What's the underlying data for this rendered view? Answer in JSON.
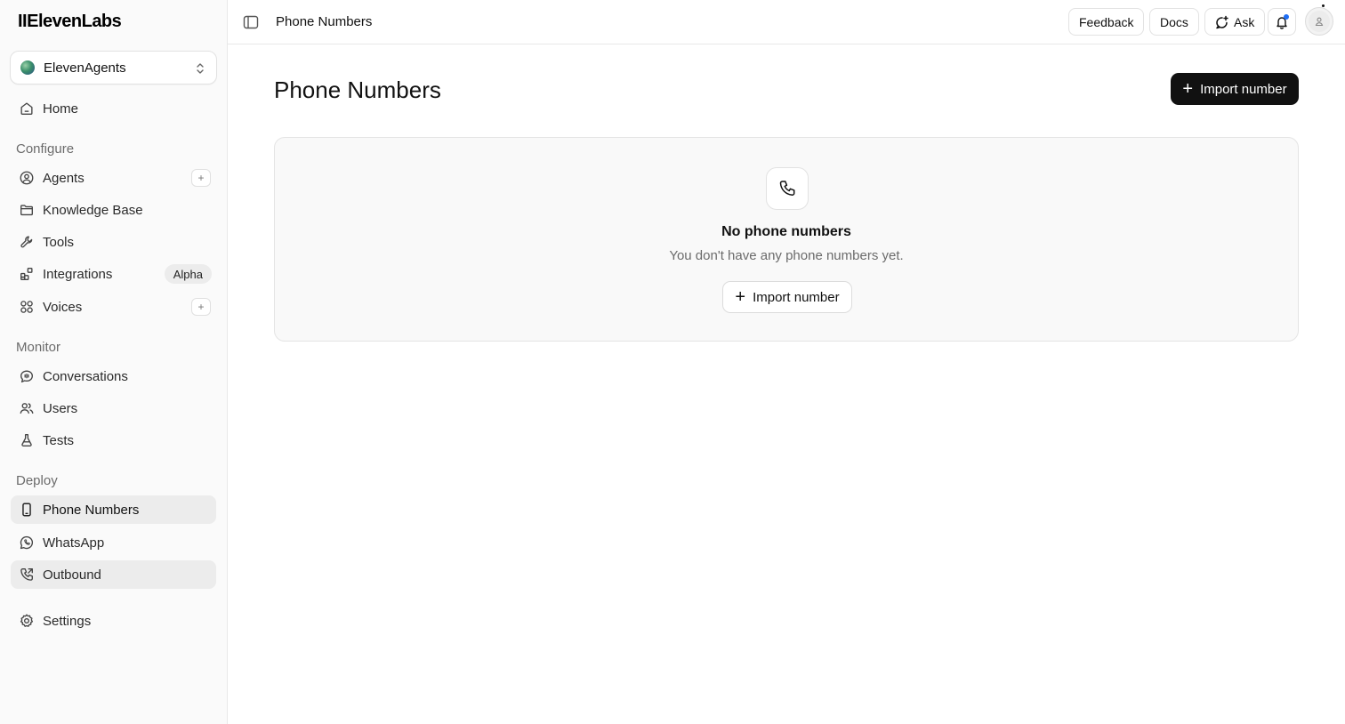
{
  "brand": {
    "name": "IIElevenLabs"
  },
  "workspace": {
    "name": "ElevenAgents"
  },
  "sidebar": {
    "home": "Home",
    "sections": {
      "configure": "Configure",
      "monitor": "Monitor",
      "deploy": "Deploy"
    },
    "configure_items": {
      "agents": "Agents",
      "knowledge_base": "Knowledge Base",
      "tools": "Tools",
      "integrations": "Integrations",
      "integrations_badge": "Alpha",
      "voices": "Voices"
    },
    "monitor_items": {
      "conversations": "Conversations",
      "users": "Users",
      "tests": "Tests"
    },
    "deploy_items": {
      "phone_numbers": "Phone Numbers",
      "whatsapp": "WhatsApp",
      "outbound": "Outbound"
    },
    "settings": "Settings",
    "active_item": "Phone Numbers"
  },
  "topbar": {
    "title": "Phone Numbers",
    "feedback": "Feedback",
    "docs": "Docs",
    "ask": "Ask"
  },
  "main": {
    "title": "Phone Numbers",
    "import_button": "Import number",
    "empty_state": {
      "title": "No phone numbers",
      "subtitle": "You don't have any phone numbers yet.",
      "button": "Import number"
    }
  },
  "colors": {
    "primary_button": "#111111",
    "active_nav": "#ececec",
    "notification_dot": "#1e6ef5"
  }
}
